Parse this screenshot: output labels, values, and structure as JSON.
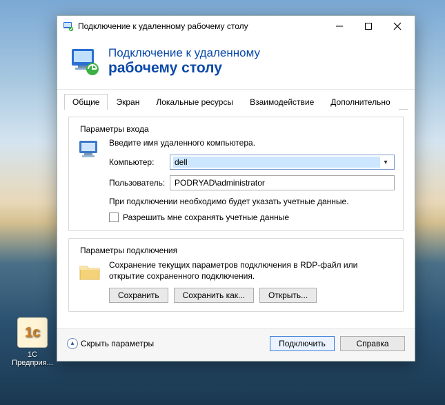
{
  "desktop": {
    "icon_label_line1": "1C",
    "icon_label_line2": "Предприя...",
    "icon_glyph": "1c"
  },
  "window": {
    "title": "Подключение к удаленному рабочему столу"
  },
  "banner": {
    "line1": "Подключение к удаленному",
    "line2": "рабочему столу"
  },
  "tabs": [
    {
      "label": "Общие",
      "active": true
    },
    {
      "label": "Экран",
      "active": false
    },
    {
      "label": "Локальные ресурсы",
      "active": false
    },
    {
      "label": "Взаимодействие",
      "active": false
    },
    {
      "label": "Дополнительно",
      "active": false
    }
  ],
  "login_group": {
    "legend": "Параметры входа",
    "intro": "Введите имя удаленного компьютера.",
    "computer_label": "Компьютер:",
    "computer_value": "dell",
    "user_label": "Пользователь:",
    "user_value": "PODRYAD\\administrator",
    "note": "При подключении необходимо будет указать учетные данные.",
    "checkbox_label": "Разрешить мне сохранять учетные данные"
  },
  "conn_group": {
    "legend": "Параметры подключения",
    "note": "Сохранение текущих параметров подключения в RDP-файл или открытие сохраненного подключения.",
    "save_btn": "Сохранить",
    "saveas_btn": "Сохранить как...",
    "open_btn": "Открыть..."
  },
  "footer": {
    "collapse": "Скрыть параметры",
    "connect": "Подключить",
    "help": "Справка"
  }
}
